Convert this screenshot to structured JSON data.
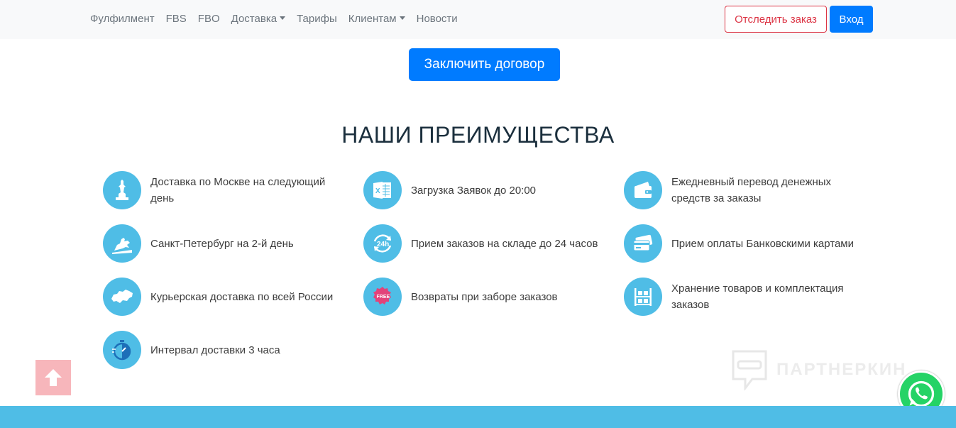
{
  "nav": {
    "links": [
      {
        "label": "Фулфилмент",
        "dropdown": false
      },
      {
        "label": "FBS",
        "dropdown": false
      },
      {
        "label": "FBO",
        "dropdown": false
      },
      {
        "label": "Доставка",
        "dropdown": true
      },
      {
        "label": "Тарифы",
        "dropdown": false
      },
      {
        "label": "Клиентам",
        "dropdown": true
      },
      {
        "label": "Новости",
        "dropdown": false
      }
    ],
    "track_label": "Отследить заказ",
    "login_label": "Вход"
  },
  "contract_label": "Заключить договор",
  "section_title": "НАШИ ПРЕИМУЩЕСТВА",
  "features": [
    {
      "text": "Доставка по Москве на следующий день",
      "icon": "monument-icon"
    },
    {
      "text": "Загрузка Заявок до 20:00",
      "icon": "excel-icon"
    },
    {
      "text": "Ежедневный перевод денежных средств за заказы",
      "icon": "wallet-icon"
    },
    {
      "text": "Санкт-Петербург на 2-й день",
      "icon": "horseman-icon"
    },
    {
      "text": "Прием заказов на складе до 24 часов",
      "icon": "24h-icon"
    },
    {
      "text": "Прием оплаты Банковскими картами",
      "icon": "card-icon"
    },
    {
      "text": "Курьерская доставка по всей России",
      "icon": "russia-map-icon"
    },
    {
      "text": "Возвраты при заборе заказов",
      "icon": "free-badge-icon"
    },
    {
      "text": "Хранение товаров и комплектация заказов",
      "icon": "shelves-icon"
    },
    {
      "text": "Интервал доставки 3 часа",
      "icon": "stopwatch-icon"
    }
  ],
  "watermark_text": "ПАРТНЕРКИН",
  "colors": {
    "accent": "#007bff",
    "feature_circle": "#4fbde6",
    "danger": "#dc3545"
  }
}
